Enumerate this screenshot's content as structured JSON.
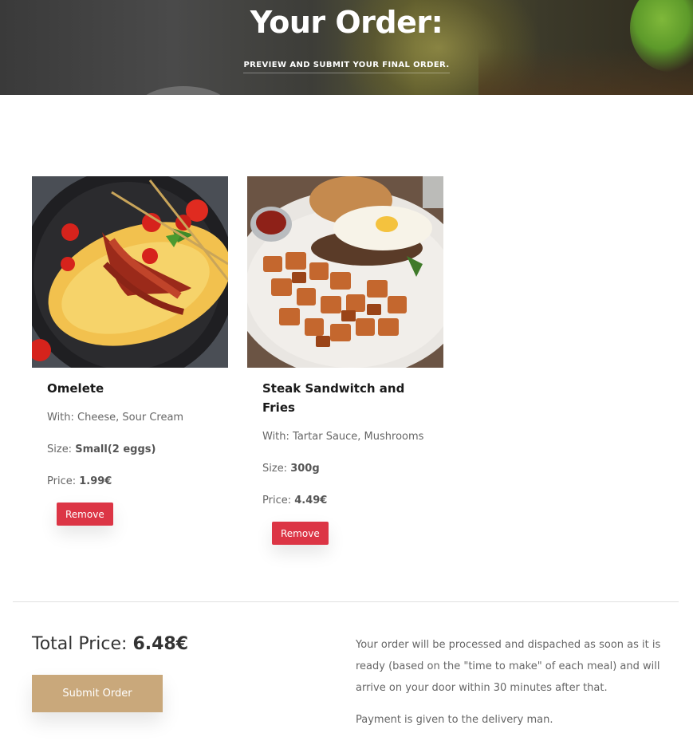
{
  "hero": {
    "title": "Your Order:",
    "subtitle": "PREVIEW AND SUBMIT YOUR FINAL ORDER."
  },
  "items": [
    {
      "name": "Omelete",
      "with_label": "With:",
      "with_value": "Cheese, Sour Cream",
      "size_label": "Size:",
      "size_value": "Small(2 eggs)",
      "price_label": "Price:",
      "price_value": "1.99€",
      "remove_label": "Remove"
    },
    {
      "name": "Steak Sandwitch and Fries",
      "with_label": "With:",
      "with_value": "Tartar Sauce, Mushrooms",
      "size_label": "Size:",
      "size_value": "300g",
      "price_label": "Price:",
      "price_value": "4.49€",
      "remove_label": "Remove"
    }
  ],
  "summary": {
    "total_label": "Total Price:",
    "total_value": "6.48€",
    "submit_label": "Submit Order",
    "note_1": "Your order will be processed and dispached as soon as it is ready (based on the \"time to make\" of each meal) and will arrive on your door within 30 minutes after that.",
    "note_2": "Payment is given to the delivery man."
  },
  "colors": {
    "remove_button": "#dc3545",
    "submit_button": "#c9a87b"
  }
}
